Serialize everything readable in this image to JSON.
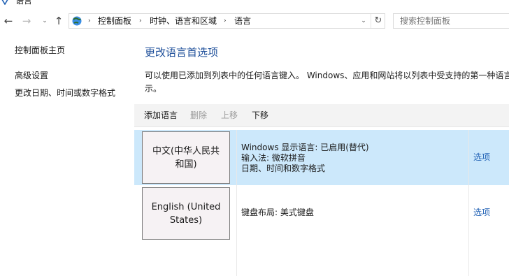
{
  "window": {
    "title": "语言"
  },
  "nav": {
    "back": "←",
    "forward": "→",
    "recent": "⌄",
    "up": "↑"
  },
  "address": {
    "breadcrumbs": [
      "控制面板",
      "时钟、语言和区域",
      "语言"
    ],
    "separator": "›",
    "dropdown": "⌄",
    "refresh": "↻"
  },
  "search": {
    "placeholder": "搜索控制面板"
  },
  "sidebar": {
    "items": [
      {
        "label": "控制面板主页"
      },
      {
        "label": "高级设置"
      },
      {
        "label": "更改日期、时间或数字格式"
      }
    ]
  },
  "main": {
    "title": "更改语言首选项",
    "description": "可以使用已添加到列表中的任何语言键入。 Windows、应用和网站将以列表中受支持的第一种语言显示。",
    "toolbar": {
      "add": "添加语言",
      "remove": "删除",
      "move_up": "上移",
      "move_down": "下移"
    },
    "languages": [
      {
        "name": "中文(中华人民共和国)",
        "details": [
          "Windows 显示语言: 已启用(替代)",
          "输入法: 微软拼音",
          "日期、时间和数字格式"
        ],
        "options": "选项",
        "selected": true
      },
      {
        "name": "English (United States)",
        "details": [
          "键盘布局: 美式键盘"
        ],
        "options": "选项",
        "selected": false
      }
    ]
  },
  "colors": {
    "selected_row": "#cce8fb",
    "link": "#1e5fb4",
    "title": "#1e4f9a"
  },
  "icons": [
    "app-icon",
    "control-panel-icon",
    "back-arrow-icon",
    "forward-arrow-icon",
    "up-arrow-icon",
    "refresh-icon",
    "dropdown-icon"
  ]
}
